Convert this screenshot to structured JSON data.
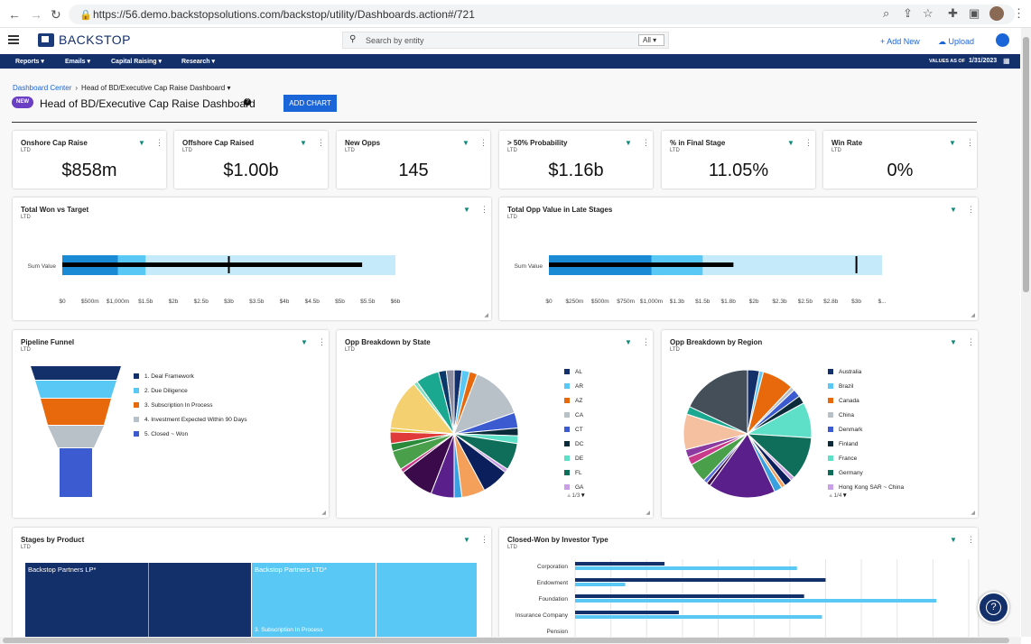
{
  "browser": {
    "url": "https://56.demo.backstopsolutions.com/backstop/utility/Dashboards.action#/721"
  },
  "app": {
    "name": "BACKSTOP",
    "search_placeholder": "Search by entity",
    "search_scope": "All",
    "add_new": "+ Add New",
    "upload": "Upload"
  },
  "nav": {
    "items": [
      "Reports",
      "Emails",
      "Capital Raising",
      "Research"
    ],
    "values_as_of_label": "VALUES AS OF",
    "values_as_of_date": "1/31/2023"
  },
  "page": {
    "breadcrumb_root": "Dashboard Center",
    "breadcrumb_current": "Head of BD/Executive Cap Raise Dashboard",
    "new_badge": "NEW",
    "title": "Head of BD/Executive Cap Raise Dashboard",
    "add_chart": "ADD CHART"
  },
  "kpis": [
    {
      "title": "Onshore Cap Raise",
      "sub": "LTD",
      "value": "$858m"
    },
    {
      "title": "Offshore Cap Raised",
      "sub": "LTD",
      "value": "$1.00b"
    },
    {
      "title": "New Opps",
      "sub": "LTD",
      "value": "145"
    },
    {
      "title": "> 50% Probability",
      "sub": "LTD",
      "value": "$1.16b"
    },
    {
      "title": "% in Final Stage",
      "sub": "LTD",
      "value": "11.05%"
    },
    {
      "title": "Win Rate",
      "sub": "LTD",
      "value": "0%"
    }
  ],
  "colors": {
    "navy": "#14306b",
    "blue": "#1a66d9",
    "teal_filter": "#0e8a7a",
    "badge": "#6b3fc4"
  },
  "chart_data": [
    {
      "type": "bullet",
      "title": "Total Won vs Target",
      "subtitle": "LTD",
      "category": "Sum Value",
      "ticks": [
        "$0",
        "$500m",
        "$1,000m",
        "$1.5b",
        "$2b",
        "$2.5b",
        "$3b",
        "$3.5b",
        "$4b",
        "$4.5b",
        "$5b",
        "$5.5b",
        "$6b"
      ],
      "xlim": [
        0,
        6
      ],
      "ranges": [
        1.0,
        1.5,
        6.0
      ],
      "actual": 5.4,
      "target": 3.0,
      "unit": "billions"
    },
    {
      "type": "bullet",
      "title": "Total Opp Value in Late Stages",
      "subtitle": "LTD",
      "category": "Sum Value",
      "ticks": [
        "$0",
        "$250m",
        "$500m",
        "$750m",
        "$1,000m",
        "$1.3b",
        "$1.5b",
        "$1.8b",
        "$2b",
        "$2.3b",
        "$2.5b",
        "$2.8b",
        "$3b",
        "$..."
      ],
      "xlim": [
        0,
        3.25
      ],
      "ranges": [
        1.0,
        1.5,
        3.25
      ],
      "actual": 1.8,
      "target": 3.0,
      "unit": "billions"
    },
    {
      "type": "funnel",
      "title": "Pipeline Funnel",
      "subtitle": "LTD",
      "stages": [
        {
          "name": "1. Deal Framework",
          "color": "#14306b"
        },
        {
          "name": "2. Due Diligence",
          "color": "#5ac8f5"
        },
        {
          "name": "3. Subscription In Process",
          "color": "#e8690b"
        },
        {
          "name": "4. Investment Expected Within 90 Days",
          "color": "#b8c0c8"
        },
        {
          "name": "5. Closed ~ Won",
          "color": "#3c5bd0"
        }
      ]
    },
    {
      "type": "pie",
      "title": "Opp Breakdown by State",
      "subtitle": "LTD",
      "page": "1/3",
      "legend": [
        {
          "name": "AL",
          "color": "#14306b"
        },
        {
          "name": "AR",
          "color": "#5ac8f5"
        },
        {
          "name": "AZ",
          "color": "#e8690b"
        },
        {
          "name": "CA",
          "color": "#b8c0c8"
        },
        {
          "name": "CT",
          "color": "#3c5bd0"
        },
        {
          "name": "DC",
          "color": "#0b2a3a"
        },
        {
          "name": "DE",
          "color": "#5ee0c8"
        },
        {
          "name": "FL",
          "color": "#0f6e5a"
        },
        {
          "name": "GA",
          "color": "#c9a0e8"
        }
      ],
      "slices": [
        {
          "v": 2,
          "color": "#14306b"
        },
        {
          "v": 2,
          "color": "#5ac8f5"
        },
        {
          "v": 2,
          "color": "#e8690b"
        },
        {
          "v": 14,
          "color": "#b8c0c8"
        },
        {
          "v": 4,
          "color": "#3c5bd0"
        },
        {
          "v": 2,
          "color": "#0b2a3a"
        },
        {
          "v": 2,
          "color": "#5ee0c8"
        },
        {
          "v": 7,
          "color": "#0f6e5a"
        },
        {
          "v": 1,
          "color": "#c9a0e8"
        },
        {
          "v": 7,
          "color": "#0b1f5c"
        },
        {
          "v": 6,
          "color": "#f5a05a"
        },
        {
          "v": 2,
          "color": "#3aa0e0"
        },
        {
          "v": 6,
          "color": "#5a1f8a"
        },
        {
          "v": 9,
          "color": "#3a0a4a"
        },
        {
          "v": 1,
          "color": "#c93a8a"
        },
        {
          "v": 5,
          "color": "#4aa04a"
        },
        {
          "v": 2,
          "color": "#2a8a3a"
        },
        {
          "v": 3,
          "color": "#e03a3a"
        },
        {
          "v": 1,
          "color": "#e8c840"
        },
        {
          "v": 13,
          "color": "#f5d070"
        },
        {
          "v": 1,
          "color": "#80e0c0"
        },
        {
          "v": 6,
          "color": "#1aa890"
        },
        {
          "v": 2,
          "color": "#0b3a6a"
        },
        {
          "v": 2,
          "color": "#8a8aa0"
        }
      ]
    },
    {
      "type": "pie",
      "title": "Opp Breakdown by Region",
      "subtitle": "LTD",
      "page": "1/4",
      "legend": [
        {
          "name": "Australia",
          "color": "#14306b"
        },
        {
          "name": "Brazil",
          "color": "#5ac8f5"
        },
        {
          "name": "Canada",
          "color": "#e8690b"
        },
        {
          "name": "China",
          "color": "#b8c0c8"
        },
        {
          "name": "Denmark",
          "color": "#3c5bd0"
        },
        {
          "name": "Finland",
          "color": "#0b2a3a"
        },
        {
          "name": "France",
          "color": "#5ee0c8"
        },
        {
          "name": "Germany",
          "color": "#0f6e5a"
        },
        {
          "name": "Hong Kong SAR ~ China",
          "color": "#c9a0e8"
        }
      ],
      "slices": [
        {
          "v": 3,
          "color": "#14306b"
        },
        {
          "v": 1,
          "color": "#5ac8f5"
        },
        {
          "v": 8,
          "color": "#e8690b"
        },
        {
          "v": 1,
          "color": "#b8c0c8"
        },
        {
          "v": 2,
          "color": "#3c5bd0"
        },
        {
          "v": 2,
          "color": "#0b2a3a"
        },
        {
          "v": 9,
          "color": "#5ee0c8"
        },
        {
          "v": 11,
          "color": "#0f6e5a"
        },
        {
          "v": 1,
          "color": "#c9a0e8"
        },
        {
          "v": 2,
          "color": "#0b1f5c"
        },
        {
          "v": 1,
          "color": "#f5a05a"
        },
        {
          "v": 2,
          "color": "#3aa0e0"
        },
        {
          "v": 17,
          "color": "#5a1f8a"
        },
        {
          "v": 1,
          "color": "#3a0a4a"
        },
        {
          "v": 1,
          "color": "#5a6ae0"
        },
        {
          "v": 5,
          "color": "#4aa04a"
        },
        {
          "v": 2,
          "color": "#c93a8a"
        },
        {
          "v": 2,
          "color": "#8a3aa0"
        },
        {
          "v": 9,
          "color": "#f5c0a0"
        },
        {
          "v": 2,
          "color": "#1aa890"
        },
        {
          "v": 18,
          "color": "#454f5a"
        }
      ]
    },
    {
      "type": "treemap",
      "title": "Stages by Product",
      "subtitle": "LTD",
      "groups": [
        {
          "name": "Backstop Partners LP*",
          "color": "#14306b",
          "share": 0.5
        },
        {
          "name": "Backstop Partners LTD*",
          "color": "#5ac8f5",
          "share": 0.5
        }
      ],
      "visible_stage_label": "3. Subscription In Process"
    },
    {
      "type": "bar",
      "orientation": "horizontal",
      "title": "Closed-Won by Investor Type",
      "subtitle": "LTD",
      "categories": [
        "Corporation",
        "Endowment",
        "Foundation",
        "Insurance Company",
        "Pension"
      ],
      "series": [
        {
          "color": "#14306b",
          "values": [
            25,
            70,
            64,
            29,
            0
          ]
        },
        {
          "color": "#5ac8f5",
          "values": [
            62,
            14,
            101,
            69,
            0
          ]
        }
      ],
      "xlim": [
        0,
        110
      ]
    }
  ]
}
